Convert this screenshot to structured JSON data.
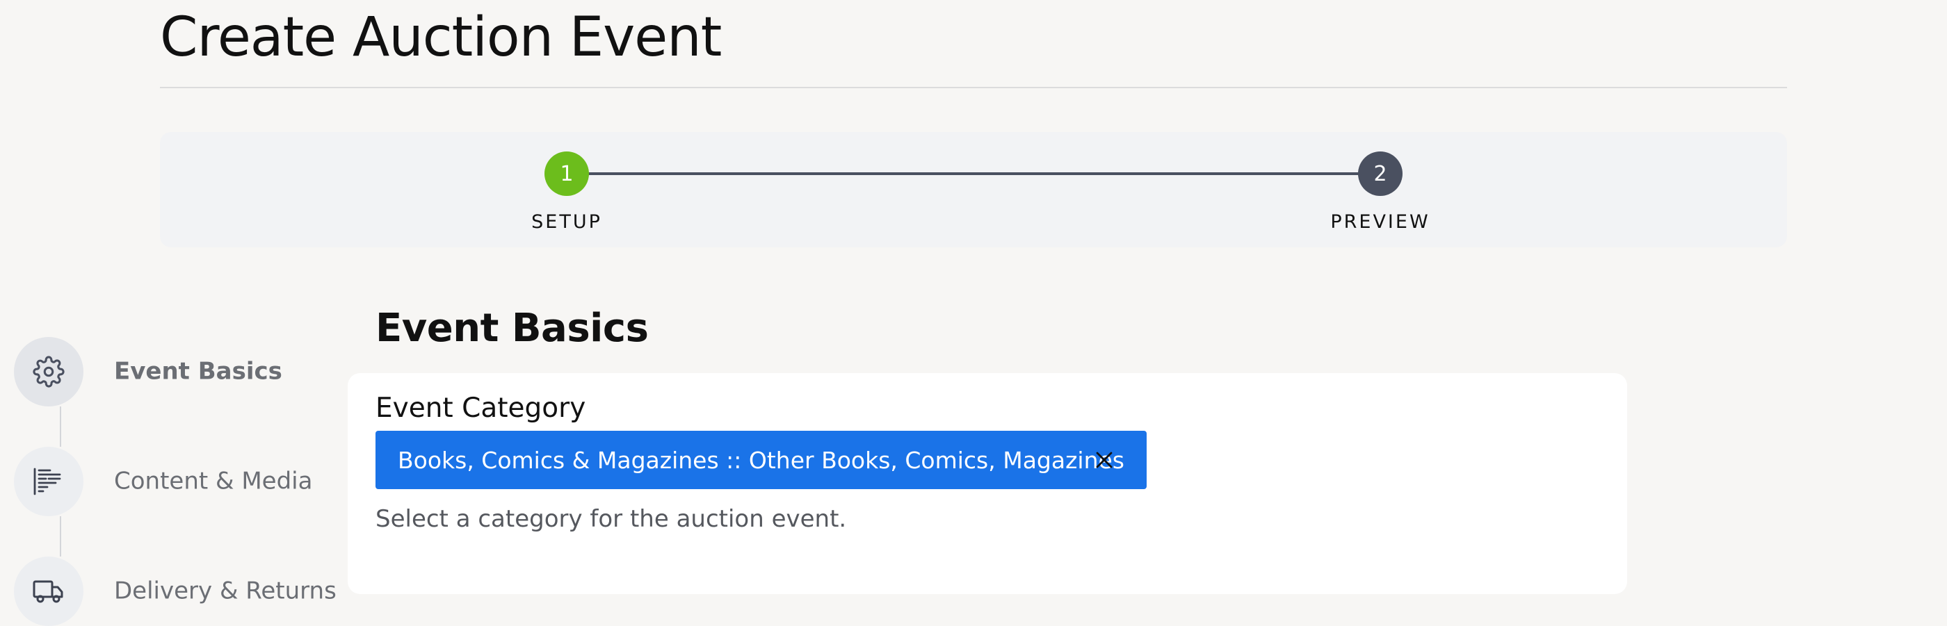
{
  "page": {
    "title": "Create Auction Event"
  },
  "stepper": {
    "steps": [
      {
        "number": "1",
        "label": "SETUP",
        "state": "active",
        "color": "#6cbd1c"
      },
      {
        "number": "2",
        "label": "PREVIEW",
        "state": "pending",
        "color": "#4a5060"
      }
    ]
  },
  "sidenav": {
    "items": [
      {
        "label": "Event Basics",
        "icon": "gear-icon",
        "active": true
      },
      {
        "label": "Content & Media",
        "icon": "text-lines-icon",
        "active": false
      },
      {
        "label": "Delivery & Returns",
        "icon": "truck-icon",
        "active": false
      }
    ]
  },
  "main": {
    "section_title": "Event Basics",
    "event_category": {
      "label": "Event Category",
      "selected_value": "Books, Comics & Magazines :: Other Books, Comics, Magazines",
      "clear_icon": "close-icon",
      "help_text": "Select a category for the auction event."
    }
  },
  "colors": {
    "accent_blue": "#1a73e8",
    "step_active_green": "#6cbd1c",
    "step_pending_gray": "#4a5060"
  }
}
